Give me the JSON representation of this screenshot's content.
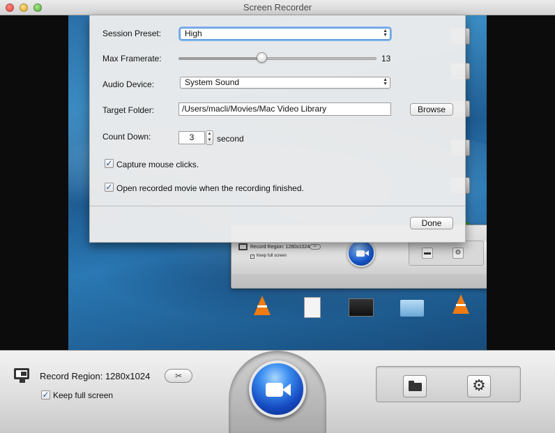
{
  "window": {
    "title": "Screen Recorder"
  },
  "settings": {
    "session_preset_label": "Session Preset:",
    "session_preset_value": "High",
    "max_framerate_label": "Max Framerate:",
    "max_framerate_value": "13",
    "max_framerate_fraction": 0.42,
    "audio_device_label": "Audio Device:",
    "audio_device_value": "System Sound",
    "target_folder_label": "Target Folder:",
    "target_folder_value": "/Users/macli/Movies/Mac Video Library",
    "browse_label": "Browse",
    "count_down_label": "Count Down:",
    "count_down_value": "3",
    "count_down_unit": "second",
    "capture_mouse_label": "Capture mouse clicks.",
    "capture_mouse_checked": true,
    "open_movie_label": "Open recorded movie when the recording finished.",
    "open_movie_checked": true,
    "done_label": "Done"
  },
  "preview": {
    "mini_record_region": "Record Region: 1280x1024",
    "mini_keep_full_screen": "Keep full screen"
  },
  "toolbar": {
    "record_region_label": "Record Region:",
    "record_region_value": "1280x1024",
    "keep_full_screen_label": "Keep full screen",
    "keep_full_screen_checked": true
  },
  "colors": {
    "record_button": "#1449c0",
    "focus_ring": "#7eb3ea"
  },
  "icons": {
    "crop": "crop-icon",
    "folder": "folder-icon",
    "gear": "gear-icon",
    "record": "video-camera-icon",
    "monitor": "monitor-icon"
  }
}
